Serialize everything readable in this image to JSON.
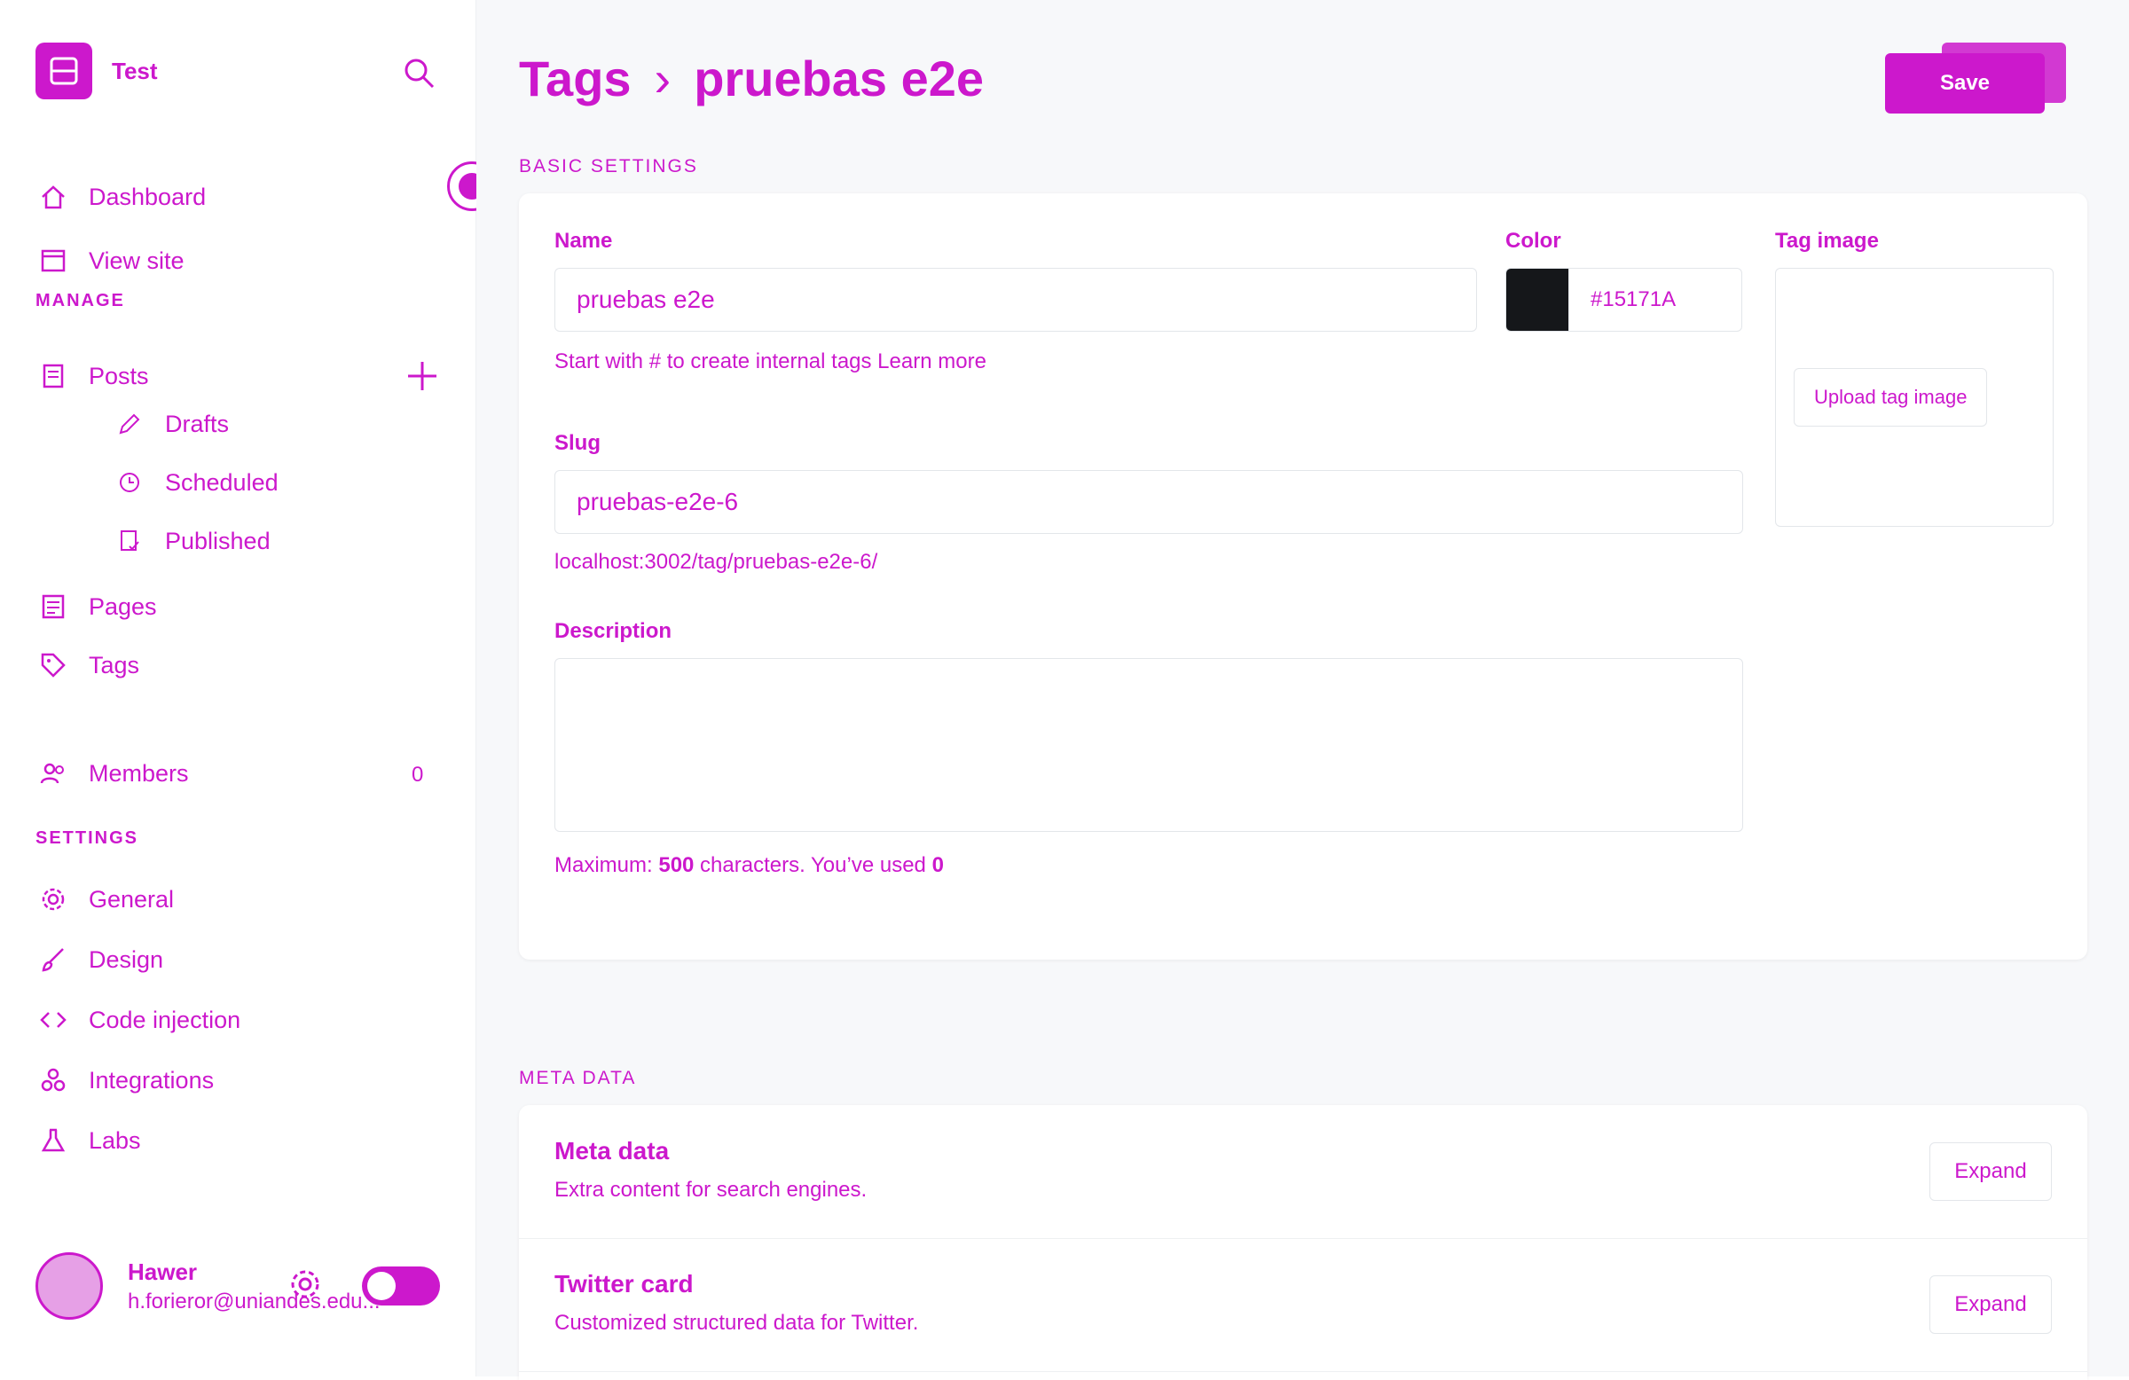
{
  "app": {
    "site_title": "Test"
  },
  "sidebar": {
    "top_items": [
      {
        "label": "Dashboard",
        "icon": "house-icon"
      },
      {
        "label": "View site",
        "icon": "browser-icon"
      }
    ],
    "manage_heading": "MANAGE",
    "posts": {
      "label": "Posts",
      "icon": "posts-icon"
    },
    "post_subitems": [
      {
        "label": "Drafts",
        "icon": "pencil-icon"
      },
      {
        "label": "Scheduled",
        "icon": "clock-icon"
      },
      {
        "label": "Published",
        "icon": "published-icon"
      }
    ],
    "manage_items": [
      {
        "label": "Pages",
        "icon": "pages-icon"
      },
      {
        "label": "Tags",
        "icon": "tag-icon"
      },
      {
        "label": "Members",
        "icon": "members-icon",
        "count": "0"
      }
    ],
    "settings_heading": "SETTINGS",
    "settings_items": [
      {
        "label": "General",
        "icon": "gear-icon"
      },
      {
        "label": "Design",
        "icon": "brush-icon"
      },
      {
        "label": "Code injection",
        "icon": "code-icon"
      },
      {
        "label": "Integrations",
        "icon": "integrations-icon"
      },
      {
        "label": "Labs",
        "icon": "flask-icon"
      }
    ],
    "user": {
      "name": "Hawer",
      "email": "h.forieror@uniandes.edu..."
    }
  },
  "header": {
    "breadcrumb_parent": "Tags",
    "breadcrumb_separator": "›",
    "breadcrumb_current": "pruebas e2e",
    "save_label": "Save"
  },
  "basic_settings": {
    "heading": "BASIC SETTINGS",
    "name_label": "Name",
    "name_value": "pruebas e2e",
    "name_hint": "Start with # to create internal tags Learn more",
    "color_label": "Color",
    "color_value": "#15171A",
    "slug_label": "Slug",
    "slug_value": "pruebas-e2e-6",
    "slug_url": "localhost:3002/tag/pruebas-e2e-6/",
    "description_label": "Description",
    "description_value": "",
    "description_hint_prefix": "Maximum: ",
    "description_max": "500",
    "description_hint_mid": " characters. You’ve used ",
    "description_used": "0",
    "tag_image_label": "Tag image",
    "upload_label": "Upload tag image"
  },
  "meta": {
    "heading": "META DATA",
    "rows": [
      {
        "title": "Meta data",
        "description": "Extra content for search engines.",
        "action": "Expand"
      },
      {
        "title": "Twitter card",
        "description": "Customized structured data for Twitter.",
        "action": "Expand"
      }
    ]
  },
  "colors": {
    "accent": "#cc18cc",
    "tag_color": "#15171a"
  }
}
